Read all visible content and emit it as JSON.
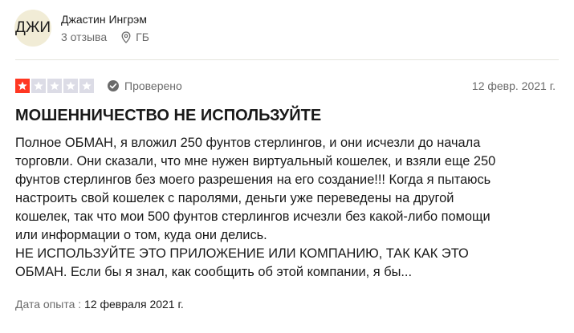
{
  "reviewer": {
    "initials": "ДЖИ",
    "name": "Джастин Ингрэм",
    "reviews_count": "3 отзыва",
    "country": "ГБ"
  },
  "rating": {
    "stars": 1,
    "max_stars": 5,
    "filled_color": "#ff3722",
    "empty_color": "#dcdce6"
  },
  "verified_label": "Проверено",
  "review_date": "12 февр. 2021 г.",
  "review": {
    "title": "МОШЕННИЧЕСТВО НЕ ИСПОЛЬЗУЙТЕ",
    "lines": [
      "Полное ОБМАН, я вложил 250 фунтов стерлингов, и они исчезли до начала",
      "торговли. Они сказали, что мне нужен виртуальный кошелек, и взяли еще 250",
      "фунтов стерлингов без моего разрешения на его создание!!! Когда я пытаюсь",
      "настроить свой кошелек с паролями, деньги уже переведены на другой",
      "кошелек, так что мои 500 фунтов стерлингов исчезли без какой-либо помощи",
      "или информации о том, куда они делись.",
      "НЕ ИСПОЛЬЗУЙТЕ ЭТО ПРИЛОЖЕНИЕ ИЛИ КОМПАНИЮ, ТАК КАК ЭТО",
      "ОБМАН. Если бы я знал, как сообщить об этой компании, я бы..."
    ]
  },
  "experience": {
    "label": "Дата опыта :",
    "date": "12 февраля 2021 г."
  },
  "icons": {
    "location": "map-pin-icon",
    "verified": "check-circle-icon",
    "star": "star-icon"
  }
}
